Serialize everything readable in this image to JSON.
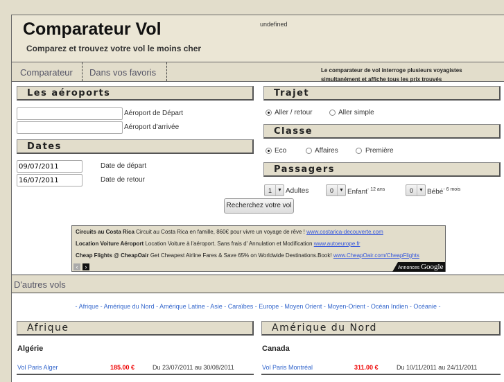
{
  "header": {
    "title": "Comparateur Vol",
    "subtitle": "Comparez et trouvez votre vol le moins cher",
    "undefined_text": "undefined"
  },
  "nav": {
    "items": [
      "Comparateur",
      "Dans vos favoris"
    ],
    "info": [
      "Le comparateur de vol interroge plusieurs voyagistes",
      "simultanément et affiche tous les prix trouvés"
    ]
  },
  "airports": {
    "title": "Les aéroports",
    "departure_label": "Aéroport de Départ",
    "arrival_label": "Aéroport d'arrivée",
    "departure_value": "",
    "arrival_value": ""
  },
  "dates": {
    "title": "Dates",
    "departure_value": "09/07/2011",
    "return_value": "16/07/2011",
    "departure_label": "Date de départ",
    "return_label": "Date de retour"
  },
  "trajet": {
    "title": "Trajet",
    "options": [
      "Aller / retour",
      "Aller simple"
    ],
    "selected": "Aller / retour"
  },
  "classe": {
    "title": "Classe",
    "options": [
      "Eco",
      "Affaires",
      "Première"
    ],
    "selected": "Eco"
  },
  "passagers": {
    "title": "Passagers",
    "adults": {
      "value": "1",
      "label": "Adultes"
    },
    "children": {
      "value": "0",
      "label": "Enfant",
      "note": "- 12 ans"
    },
    "babies": {
      "value": "0",
      "label": "Bébé",
      "note": "- 6 mois"
    }
  },
  "search_button": "Recherchez votre vol",
  "ads": {
    "items": [
      {
        "title": "Circuits au Costa Rica",
        "text": "Circuit au Costa Rica en famille, 860€ pour vivre un voyage de rêve !",
        "url": "www.costarica-decouverte.com"
      },
      {
        "title": "Location Voiture Aéroport",
        "text": "Location Voiture à l'aéroport. Sans frais d' Annulation et Modification",
        "url": "www.autoeurope.fr"
      },
      {
        "title": "Cheap Flights @ CheapOair",
        "text": "Get Cheapest Airline Fares & Save 65% on Worldwide Destinations.Book!",
        "url": "www.CheapOair.com/CheapFlights"
      }
    ],
    "badge_prefix": "Annonces",
    "badge_brand": "Google"
  },
  "others": {
    "title": "D'autres vols",
    "regions": [
      "Afrique",
      "Amérique du Nord",
      "Amérique Latine",
      "Asie",
      "Caraïbes",
      "Europe",
      "Moyen Orient",
      "Moyen-Orient",
      "Océan Indien",
      "Océanie"
    ]
  },
  "blocks": [
    {
      "title": "Afrique",
      "country": "Algérie",
      "route": "Vol Paris Alger",
      "price": "185.00 €",
      "dates": "Du 23/07/2011 au 30/08/2011"
    },
    {
      "title": "Amérique du Nord",
      "country": "Canada",
      "route": "Vol Paris Montréal",
      "price": "311.00 €",
      "dates": "Du 10/11/2011 au 24/11/2011"
    }
  ],
  "colors": {
    "background": "#e2ddcb",
    "header": "#ebe6d5",
    "link": "#3366cc",
    "price": "#e00000"
  }
}
